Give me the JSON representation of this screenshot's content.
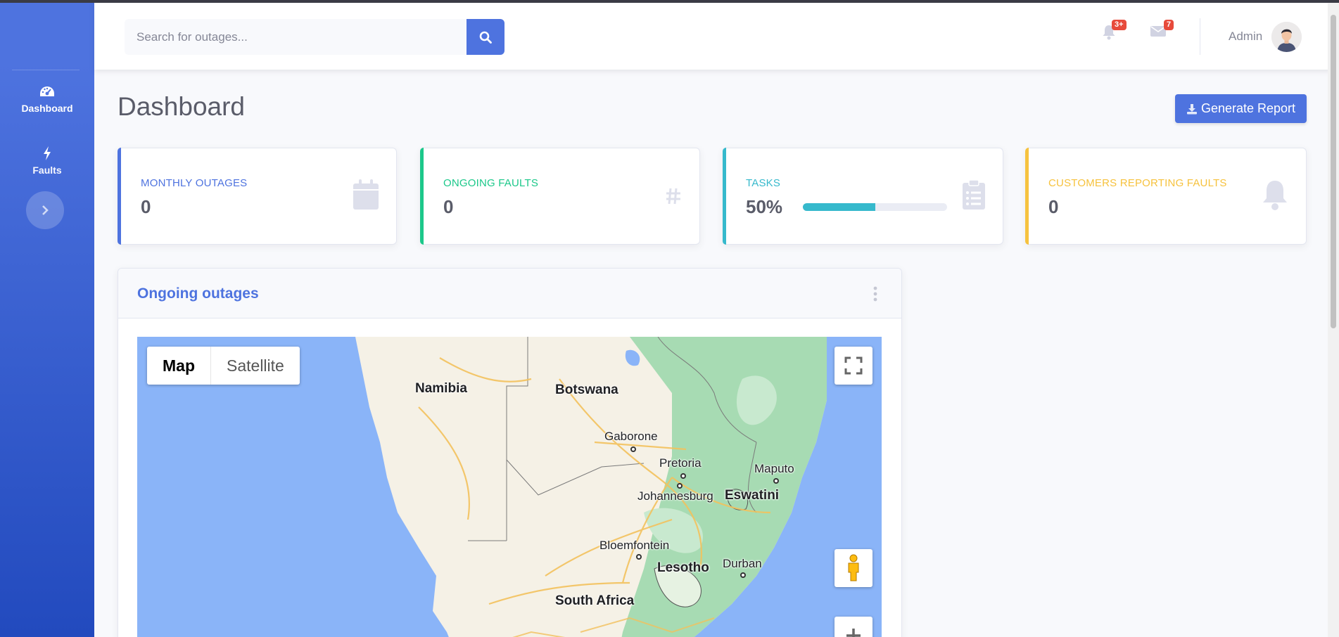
{
  "sidebar": {
    "items": [
      {
        "label": "Dashboard",
        "icon": "tachometer-icon"
      },
      {
        "label": "Faults",
        "icon": "bolt-icon"
      }
    ],
    "toggle_icon": "chevron-right-icon"
  },
  "topbar": {
    "search_placeholder": "Search for outages...",
    "notifications_badge": "3+",
    "messages_badge": "7",
    "user_name": "Admin"
  },
  "page": {
    "title": "Dashboard",
    "generate_report_label": "Generate Report"
  },
  "cards": [
    {
      "label": "MONTHLY OUTAGES",
      "value": "0",
      "icon": "calendar-icon",
      "color": "#4e73df"
    },
    {
      "label": "ONGOING FAULTS",
      "value": "0",
      "icon": "hashtag-icon",
      "color": "#1cc88a"
    },
    {
      "label": "TASKS",
      "value": "50%",
      "progress": 0.5,
      "icon": "clipboard-list-icon",
      "color": "#36b9cc"
    },
    {
      "label": "CUSTOMERS REPORTING FAULTS",
      "value": "0",
      "icon": "bell-icon",
      "color": "#f6c23e"
    }
  ],
  "outages_panel": {
    "title": "Ongoing outages",
    "map": {
      "type_options": [
        "Map",
        "Satellite"
      ],
      "selected_type": "Map",
      "labels": {
        "namibia": "Namibia",
        "botswana": "Botswana",
        "gaborone": "Gaborone",
        "pretoria": "Pretoria",
        "maputo": "Maputo",
        "johannesburg": "Johannesburg",
        "eswatini": "Eswatini",
        "bloemfontein": "Bloemfontein",
        "lesotho": "Lesotho",
        "durban": "Durban",
        "south_africa": "South Africa"
      }
    }
  },
  "colors": {
    "primary": "#4e73df",
    "success": "#1cc88a",
    "info": "#36b9cc",
    "warning": "#f6c23e",
    "danger": "#e74a3b"
  }
}
